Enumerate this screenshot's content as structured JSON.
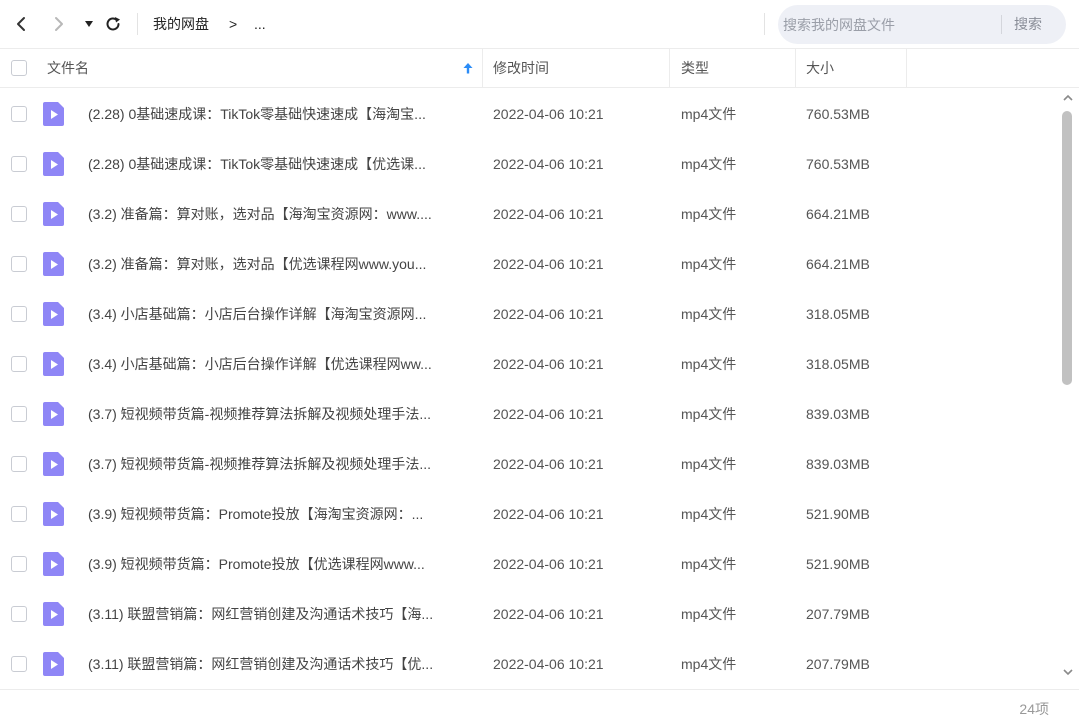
{
  "toolbar": {
    "breadcrumb_root": "我的网盘",
    "breadcrumb_sep": ">",
    "breadcrumb_more": "...",
    "search_placeholder": "搜索我的网盘文件",
    "search_button": "搜索"
  },
  "header": {
    "name": "文件名",
    "modified": "修改时间",
    "type": "类型",
    "size": "大小"
  },
  "files": [
    {
      "name": "(2.28) 0基础速成课：TikTok零基础快速速成【海淘宝...",
      "modified": "2022-04-06 10:21",
      "type": "mp4文件",
      "size": "760.53MB"
    },
    {
      "name": "(2.28) 0基础速成课：TikTok零基础快速速成【优选课...",
      "modified": "2022-04-06 10:21",
      "type": "mp4文件",
      "size": "760.53MB"
    },
    {
      "name": "(3.2) 准备篇：算对账，选对品【海淘宝资源网：www....",
      "modified": "2022-04-06 10:21",
      "type": "mp4文件",
      "size": "664.21MB"
    },
    {
      "name": "(3.2) 准备篇：算对账，选对品【优选课程网www.you...",
      "modified": "2022-04-06 10:21",
      "type": "mp4文件",
      "size": "664.21MB"
    },
    {
      "name": "(3.4) 小店基础篇：小店后台操作详解【海淘宝资源网...",
      "modified": "2022-04-06 10:21",
      "type": "mp4文件",
      "size": "318.05MB"
    },
    {
      "name": "(3.4) 小店基础篇：小店后台操作详解【优选课程网ww...",
      "modified": "2022-04-06 10:21",
      "type": "mp4文件",
      "size": "318.05MB"
    },
    {
      "name": "(3.7) 短视频带货篇-视频推荐算法拆解及视频处理手法...",
      "modified": "2022-04-06 10:21",
      "type": "mp4文件",
      "size": "839.03MB"
    },
    {
      "name": "(3.7) 短视频带货篇-视频推荐算法拆解及视频处理手法...",
      "modified": "2022-04-06 10:21",
      "type": "mp4文件",
      "size": "839.03MB"
    },
    {
      "name": "(3.9) 短视频带货篇：Promote投放【海淘宝资源网：...",
      "modified": "2022-04-06 10:21",
      "type": "mp4文件",
      "size": "521.90MB"
    },
    {
      "name": "(3.9) 短视频带货篇：Promote投放【优选课程网www...",
      "modified": "2022-04-06 10:21",
      "type": "mp4文件",
      "size": "521.90MB"
    },
    {
      "name": "(3.11) 联盟营销篇：网红营销创建及沟通话术技巧【海...",
      "modified": "2022-04-06 10:21",
      "type": "mp4文件",
      "size": "207.79MB"
    },
    {
      "name": "(3.11) 联盟营销篇：网红营销创建及沟通话术技巧【优...",
      "modified": "2022-04-06 10:21",
      "type": "mp4文件",
      "size": "207.79MB"
    }
  ],
  "footer": {
    "count": "24项"
  },
  "icons": {
    "back": "chevron-left-icon",
    "forward": "chevron-right-icon",
    "dropdown": "caret-down-icon",
    "refresh": "refresh-icon",
    "sort": "arrow-up-icon",
    "file": "video-file-icon"
  },
  "colors": {
    "accent": "#2b8cf7",
    "file_icon": "#8f86f6",
    "search_bg": "#eef0f6"
  }
}
